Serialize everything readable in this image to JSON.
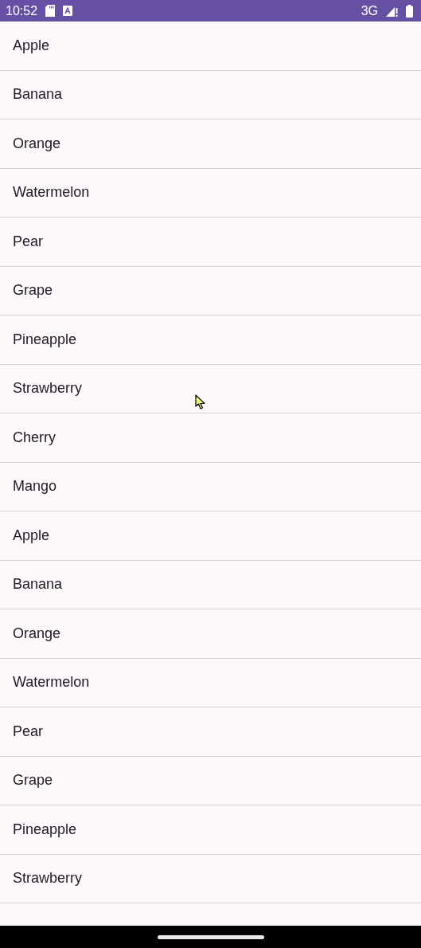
{
  "status_bar": {
    "time": "10:52",
    "network": "3G"
  },
  "list": {
    "items": [
      {
        "label": "Apple"
      },
      {
        "label": "Banana"
      },
      {
        "label": "Orange"
      },
      {
        "label": "Watermelon"
      },
      {
        "label": "Pear"
      },
      {
        "label": "Grape"
      },
      {
        "label": "Pineapple"
      },
      {
        "label": "Strawberry"
      },
      {
        "label": "Cherry"
      },
      {
        "label": "Mango"
      },
      {
        "label": "Apple"
      },
      {
        "label": "Banana"
      },
      {
        "label": "Orange"
      },
      {
        "label": "Watermelon"
      },
      {
        "label": "Pear"
      },
      {
        "label": "Grape"
      },
      {
        "label": "Pineapple"
      },
      {
        "label": "Strawberry"
      }
    ]
  }
}
